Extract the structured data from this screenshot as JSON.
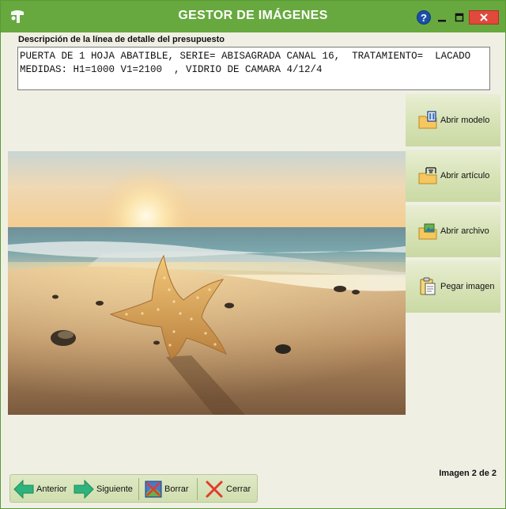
{
  "window": {
    "title": "GESTOR DE IMÁGENES",
    "help_label": "?"
  },
  "description": {
    "label": "Descripción de la línea de detalle del presupuesto",
    "line1": "PUERTA DE 1 HOJA ABATIBLE, SERIE= ABISAGRADA CANAL 16,  TRATAMIENTO=  LACADO",
    "line2": "MEDIDAS: H1=1000 V1=2100  , VIDRIO DE CAMARA 4/12/4"
  },
  "side_buttons": [
    {
      "label": "Abrir modelo",
      "icon": "open-model-icon"
    },
    {
      "label": "Abrir artículo",
      "icon": "open-article-icon"
    },
    {
      "label": "Abrir archivo",
      "icon": "open-file-icon"
    },
    {
      "label": "Pegar imagen",
      "icon": "paste-image-icon"
    }
  ],
  "image": {
    "subject": "starfish-on-beach-sunset"
  },
  "counter": "Imagen 2 de 2",
  "toolbar": {
    "prev_label": "Anterior",
    "next_label": "Siguiente",
    "delete_label": "Borrar",
    "close_label": "Cerrar"
  },
  "colors": {
    "titlebar": "#67a93f",
    "window_bg": "#f0efe3",
    "close_button": "#e0493c",
    "arrow_green": "#2fb37c"
  }
}
